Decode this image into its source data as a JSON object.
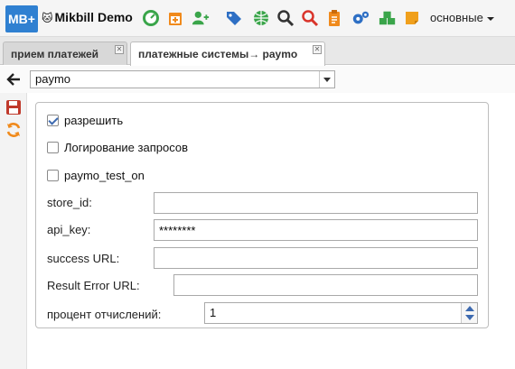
{
  "app": {
    "logo_text": "MB+",
    "brand": "Mikbill Demo",
    "brand_icon": "cat-icon"
  },
  "toolbar_icons": [
    "speedometer-icon",
    "calendar-add-icon",
    "user-add-icon",
    "tags-icon",
    "globe-icon",
    "search-icon",
    "search-red-icon",
    "clipboard-icon",
    "gears-icon",
    "cubes-icon",
    "sticky-note-icon"
  ],
  "menu": {
    "main_label": "основные"
  },
  "tabs": [
    {
      "label": "прием платежей"
    },
    {
      "label": "платежные системы→ paymo"
    }
  ],
  "selector": {
    "value": "paymo"
  },
  "form": {
    "enable": {
      "label": "разрешить",
      "checked": true
    },
    "log_requests": {
      "label": "Логирование запросов",
      "checked": false
    },
    "test_mode": {
      "label": "paymo_test_on",
      "checked": false
    },
    "store_id": {
      "label": "store_id:",
      "value": ""
    },
    "api_key": {
      "label": "api_key:",
      "value": "********"
    },
    "success_url": {
      "label": "success URL:",
      "value": ""
    },
    "error_url": {
      "label": "Result Error URL:",
      "value": ""
    },
    "percent": {
      "label": "процент отчислений:",
      "value": "1"
    }
  },
  "colors": {
    "accent": "#2f80d1",
    "green": "#3aa54a",
    "orange": "#f08a1c",
    "red": "#d9342b",
    "blue": "#2e6fc4"
  }
}
